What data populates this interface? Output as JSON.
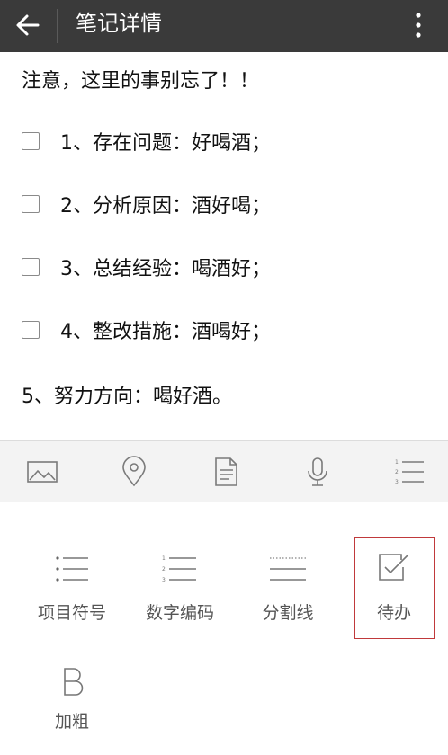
{
  "header": {
    "title": "笔记详情",
    "back_icon": "arrow-left-icon",
    "menu_icon": "more-vertical-icon"
  },
  "note": {
    "headline": "注意，这里的事别忘了！！",
    "todos": [
      {
        "text": "1、存在问题：好喝酒；",
        "checked": false
      },
      {
        "text": "2、分析原因：酒好喝；",
        "checked": false
      },
      {
        "text": "3、总结经验：喝酒好；",
        "checked": false
      },
      {
        "text": "4、整改措施：酒喝好；",
        "checked": false
      }
    ],
    "closing_line": "5、努力方向：喝好酒。"
  },
  "icon_bar": [
    "image-icon",
    "location-pin-icon",
    "document-icon",
    "microphone-icon",
    "list-icon"
  ],
  "format_panel": {
    "tools": [
      {
        "label": "项目符号",
        "icon": "bullet-list-icon"
      },
      {
        "label": "数字编码",
        "icon": "numbered-list-icon"
      },
      {
        "label": "分割线",
        "icon": "divider-line-icon"
      },
      {
        "label": "待办",
        "icon": "checkbox-todo-icon",
        "highlighted": true
      },
      {
        "label": "加粗",
        "icon": "bold-b-icon"
      }
    ]
  },
  "colors": {
    "header_bg": "#3a3a3a",
    "highlight_border": "#c0393b",
    "icon_gray": "#7a7a7a"
  }
}
